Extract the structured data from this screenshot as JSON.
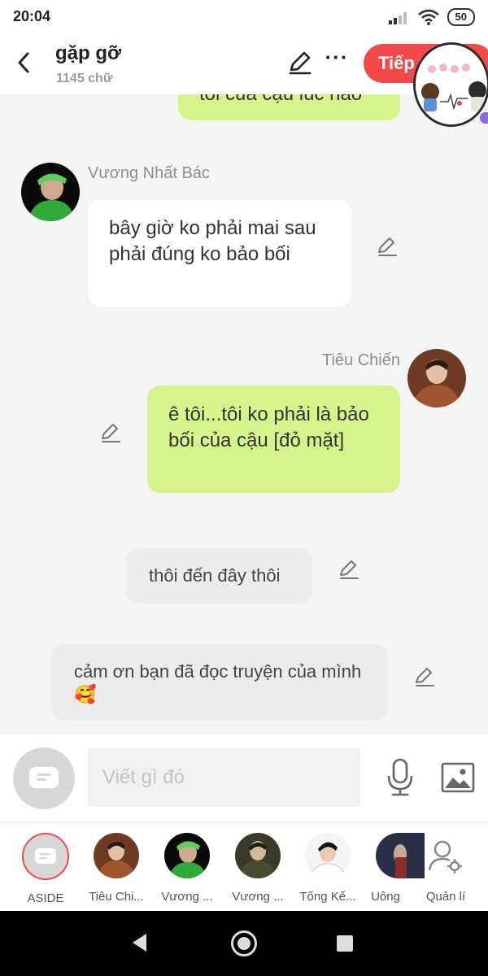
{
  "status_bar": {
    "time": "20:04",
    "battery": "50"
  },
  "header": {
    "title": "gặp gỡ",
    "subtitle": "1145 chữ",
    "continue_label": "Tiếp t"
  },
  "chat": {
    "partial_top_text": "tôi của cậu lúc nào",
    "messages": [
      {
        "sender": "Vương Nhất Bác",
        "text": "bây giờ ko phải mai sau phải đúng ko bảo bối"
      },
      {
        "sender": "Tiêu Chiến",
        "text": "ê tôi...tôi ko phải là bảo bối của cậu [đỏ mặt]"
      },
      {
        "text": "thôi đến đây thôi"
      },
      {
        "text": "cảm ơn bạn đã đọc truyện của mình 🥰"
      }
    ]
  },
  "input": {
    "placeholder": "Viết gì đó"
  },
  "characters": [
    {
      "label": "ASIDE"
    },
    {
      "label": "Tiêu Chi..."
    },
    {
      "label": "Vương ..."
    },
    {
      "label": "Vương ..."
    },
    {
      "label": "Tống Kế..."
    },
    {
      "label": "Uông"
    },
    {
      "label": "Quản lí"
    }
  ],
  "colors": {
    "accent": "#f2494d",
    "bubble_green": "#d6f48c",
    "bubble_gray": "#ececec",
    "background": "#f4f4f4"
  },
  "icons": {
    "back": "chevron-left-icon",
    "edit": "pencil-icon",
    "more": "more-dots-icon",
    "mic": "microphone-icon",
    "image": "image-icon",
    "aside": "chat-bubble-icon",
    "manage": "user-gear-icon"
  }
}
